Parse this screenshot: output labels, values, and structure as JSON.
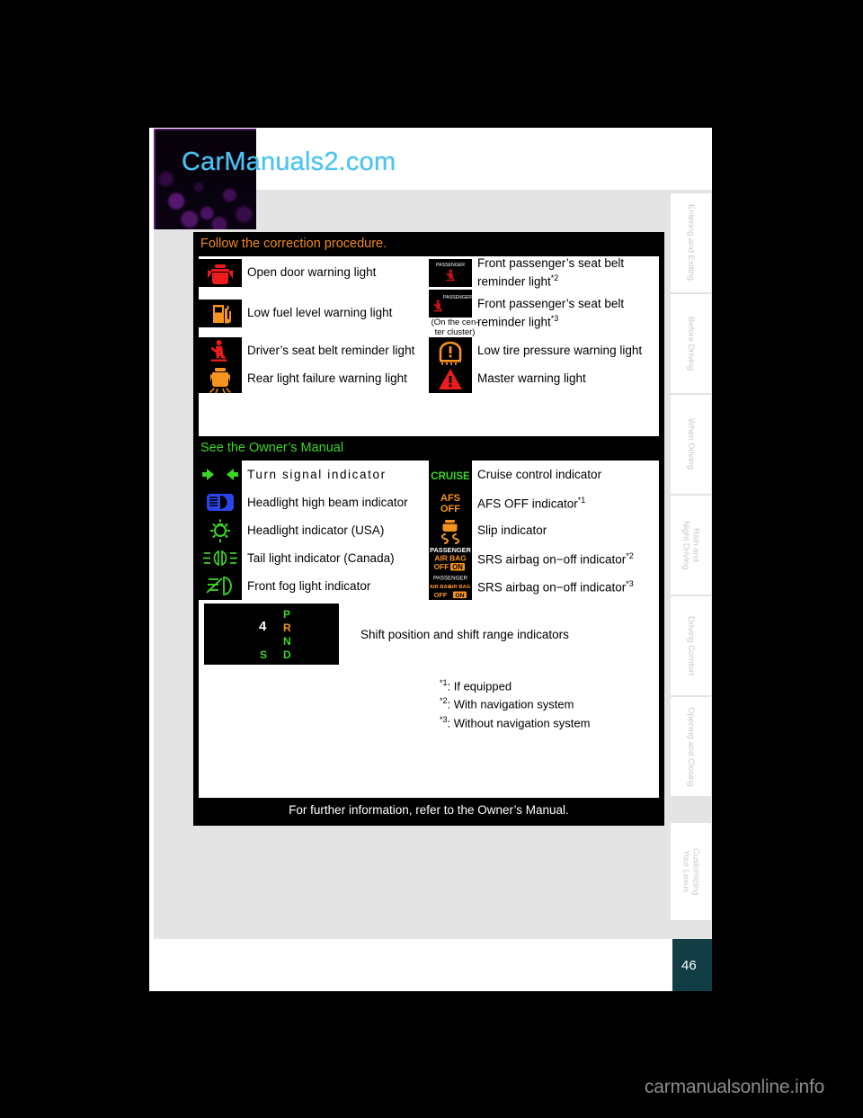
{
  "watermark": "carmanualsonline.info",
  "logo": {
    "text": "CarManuals2.com"
  },
  "page": {
    "number": "46"
  },
  "sidebar": {
    "tabs": [
      {
        "label": "Entering and Exiting"
      },
      {
        "label": "Before Driving"
      },
      {
        "label": "When Driving"
      },
      {
        "label": "Rain and\nNight Driving"
      },
      {
        "label": "Driving Comfort"
      },
      {
        "label": "Opening and Closing"
      },
      {
        "label": "Customizing\nYour Lexus"
      }
    ]
  },
  "manual": {
    "section1": {
      "title": "Follow the correction procedure.",
      "rows": [
        {
          "left": {
            "icon": "open-door-warning-icon",
            "label": "Open door warning light"
          },
          "right": {
            "icon": "front-passenger-seat-belt-icon",
            "label": "Front passenger’s seat belt reminder light",
            "footnote": "*2"
          }
        },
        {
          "left": {
            "icon": "low-fuel-level-warning-icon",
            "label": "Low fuel level warning light"
          },
          "right": {
            "icon": "front-passenger-seat-belt-center-icon",
            "label": "Front passenger’s seat belt reminder light",
            "footnote": "*3",
            "subnote": "(On the cen-\nter cluster)"
          }
        },
        {
          "left": {
            "icon": "driver-seat-belt-reminder-icon",
            "label": "Driver’s seat belt reminder light"
          },
          "right": {
            "icon": "low-tire-pressure-warning-icon",
            "label": "Low tire pressure warning light"
          }
        },
        {
          "left": {
            "icon": "rear-light-failure-warning-icon",
            "label": "Rear light failure warning light"
          },
          "right": {
            "icon": "master-warning-icon",
            "label": "Master warning light"
          }
        }
      ]
    },
    "section2": {
      "title": "See the Owner’s Manual",
      "rows": [
        {
          "left": {
            "icon": "turn-signal-indicator-icon",
            "label": "Turn signal indicator"
          },
          "right": {
            "icon": "cruise-control-indicator-icon",
            "label": "Cruise control indicator"
          }
        },
        {
          "left": {
            "icon": "headlight-high-beam-icon",
            "label": "Headlight high beam indicator"
          },
          "right": {
            "icon": "afs-off-indicator-icon",
            "label": "AFS OFF indicator",
            "footnote": "*1"
          }
        },
        {
          "left": {
            "icon": "headlight-indicator-icon",
            "label": "Headlight indicator (USA)"
          },
          "right": {
            "icon": "slip-indicator-icon",
            "label": "Slip indicator"
          }
        },
        {
          "left": {
            "icon": "tail-light-indicator-icon",
            "label": "Tail light indicator (Canada)"
          },
          "right": {
            "icon": "srs-airbag-on-off-nav-icon",
            "label": "SRS airbag on−off indicator",
            "footnote": "*2"
          }
        },
        {
          "left": {
            "icon": "front-fog-light-indicator-icon",
            "label": "Front fog light indicator"
          },
          "right": {
            "icon": "srs-airbag-on-off-nonav-icon",
            "label": "SRS airbag on−off indicator",
            "footnote": "*3"
          }
        }
      ],
      "shift": {
        "icon": "shift-position-indicator-icon",
        "label": "Shift position and shift range indicators",
        "letters": {
          "p": "P",
          "r": "R",
          "n": "N",
          "d": "D",
          "s": "S",
          "gear": "4"
        }
      },
      "footnotes": [
        {
          "mark": "*1",
          "text": ": If equipped"
        },
        {
          "mark": "*2",
          "text": ": With navigation system"
        },
        {
          "mark": "*3",
          "text": ": Without navigation system"
        }
      ]
    },
    "footer": "For further information, refer to the Owner’s Manual."
  },
  "colors": {
    "orange_title": "#f08a1e",
    "green_title": "#3bd624",
    "page_tab": "#123d45",
    "logo_cyan": "#4cc3f0",
    "warn_red": "#ee1c1c",
    "warn_orange": "#f79420",
    "indicator_green": "#3bd624",
    "indicator_blue": "#2b44ee"
  }
}
